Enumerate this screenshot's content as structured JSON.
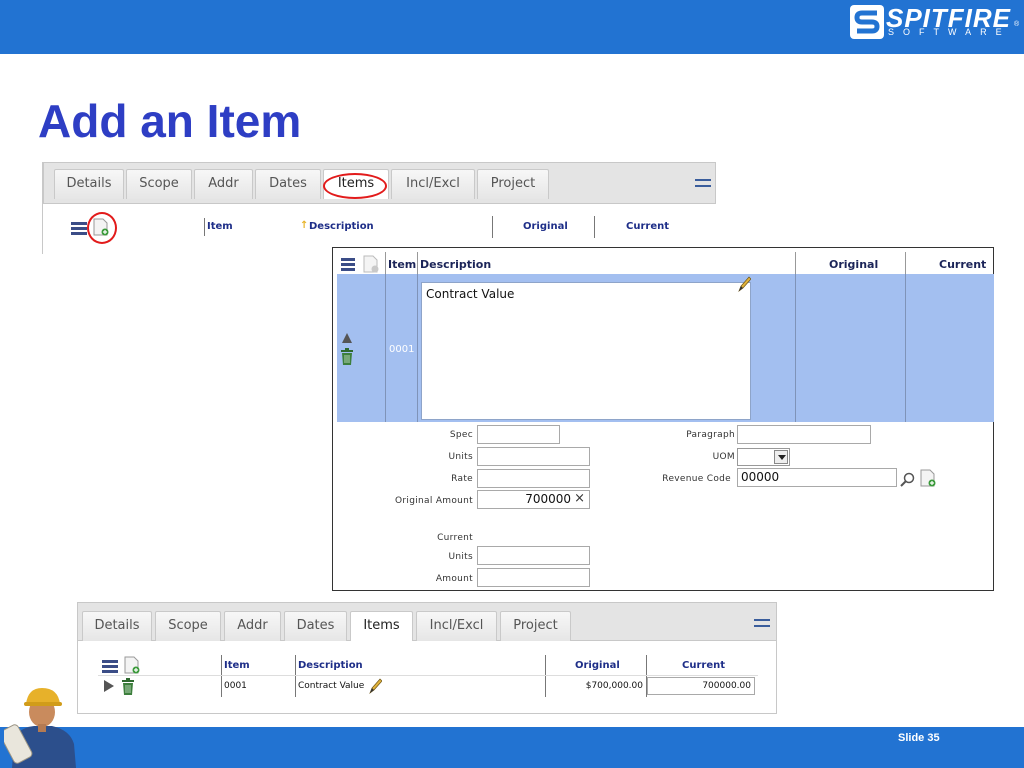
{
  "slide": {
    "title": "Add an Item",
    "number_label": "Slide 35",
    "brand_main": "SPITFIRE",
    "brand_sub": "SOFTWARE",
    "brand_reg": "®",
    "colors": {
      "band": "#2273d2",
      "title": "#2e3ec4",
      "highlight_row": "#a3bff0",
      "callout": "#e21b1b"
    }
  },
  "top_panel": {
    "tabs": [
      "Details",
      "Scope",
      "Addr",
      "Dates",
      "Items",
      "Incl/Excl",
      "Project"
    ],
    "active_tab": "Items",
    "columns": {
      "item": "Item",
      "description": "Description",
      "original": "Original",
      "current": "Current"
    },
    "icons": [
      "list-icon",
      "add-item-icon",
      "tab-menu-icon"
    ]
  },
  "detail_panel": {
    "columns": {
      "item": "Item",
      "description": "Description",
      "original": "Original",
      "current": "Current"
    },
    "row": {
      "item": "0001",
      "description": "Contract Value"
    },
    "fields": {
      "spec_label": "Spec",
      "spec_value": "",
      "units_label": "Units",
      "units_value": "",
      "rate_label": "Rate",
      "rate_value": "",
      "original_amount_label": "Original Amount",
      "original_amount_value": "700000",
      "current_label": "Current",
      "current_units_label": "Units",
      "current_units_value": "",
      "current_amount_label": "Amount",
      "current_amount_value": "",
      "paragraph_label": "Paragraph",
      "paragraph_value": "",
      "uom_label": "UOM",
      "uom_value": "",
      "revenue_code_label": "Revenue Code",
      "revenue_code_value": "00000"
    },
    "clear_glyph": "×",
    "icons": [
      "list-icon",
      "add-item-icon",
      "move-up-icon",
      "trash-icon",
      "edit-pencil-icon",
      "search-icon",
      "add-code-icon"
    ]
  },
  "bottom_panel": {
    "tabs": [
      "Details",
      "Scope",
      "Addr",
      "Dates",
      "Items",
      "Incl/Excl",
      "Project"
    ],
    "active_tab": "Items",
    "columns": {
      "item": "Item",
      "description": "Description",
      "original": "Original",
      "current": "Current"
    },
    "row": {
      "item": "0001",
      "description": "Contract Value",
      "original": "$700,000.00",
      "current": "700000.00"
    }
  }
}
